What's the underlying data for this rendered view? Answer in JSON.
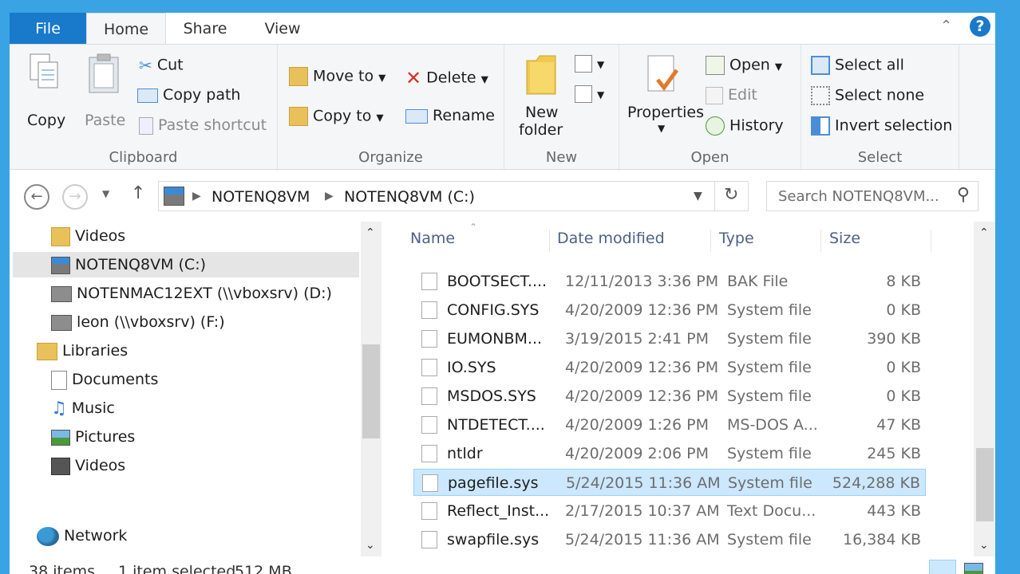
{
  "ribbon_tabs": {
    "file": "File",
    "home": "Home",
    "share": "Share",
    "view": "View"
  },
  "help": "?",
  "clipboard": {
    "copy": "Copy",
    "paste": "Paste",
    "cut": "Cut",
    "copy_path": "Copy path",
    "paste_shortcut": "Paste shortcut",
    "label": "Clipboard"
  },
  "organize": {
    "move_to": "Move to",
    "copy_to": "Copy to",
    "delete": "Delete",
    "rename": "Rename",
    "label": "Organize"
  },
  "new": {
    "new_folder_line1": "New",
    "new_folder_line2": "folder",
    "label": "New"
  },
  "open": {
    "properties": "Properties",
    "open": "Open",
    "edit": "Edit",
    "history": "History",
    "label": "Open"
  },
  "select": {
    "select_all": "Select all",
    "select_none": "Select none",
    "invert": "Invert selection",
    "label": "Select"
  },
  "address": {
    "part1": "NOTENQ8VM",
    "part2": "NOTENQ8VM (C:)"
  },
  "search": {
    "placeholder": "Search NOTENQ8VM..."
  },
  "nav_pane": {
    "items": [
      {
        "label": "Videos",
        "icon": "video-folder-icon"
      },
      {
        "label": "NOTENQ8VM (C:)",
        "icon": "drive-icon"
      },
      {
        "label": "NOTENMAC12EXT (\\\\vboxsrv) (D:)",
        "icon": "network-drive-icon"
      },
      {
        "label": "leon (\\\\vboxsrv) (F:)",
        "icon": "network-drive-icon"
      },
      {
        "label": "Libraries",
        "icon": "libraries-icon"
      },
      {
        "label": "Documents",
        "icon": "documents-icon"
      },
      {
        "label": "Music",
        "icon": "music-icon"
      },
      {
        "label": "Pictures",
        "icon": "pictures-icon"
      },
      {
        "label": "Videos",
        "icon": "videos-icon"
      },
      {
        "label": "Network",
        "icon": "network-icon"
      }
    ]
  },
  "columns": {
    "name": "Name",
    "date": "Date modified",
    "type": "Type",
    "size": "Size"
  },
  "files": [
    {
      "name": "BOOTSECT....",
      "date": "12/11/2013 3:36 PM",
      "type": "BAK File",
      "size": "8 KB"
    },
    {
      "name": "CONFIG.SYS",
      "date": "4/20/2009 12:36 PM",
      "type": "System file",
      "size": "0 KB"
    },
    {
      "name": "EUMONBM...",
      "date": "3/19/2015 2:41 PM",
      "type": "System file",
      "size": "390 KB"
    },
    {
      "name": "IO.SYS",
      "date": "4/20/2009 12:36 PM",
      "type": "System file",
      "size": "0 KB"
    },
    {
      "name": "MSDOS.SYS",
      "date": "4/20/2009 12:36 PM",
      "type": "System file",
      "size": "0 KB"
    },
    {
      "name": "NTDETECT....",
      "date": "4/20/2009 1:26 PM",
      "type": "MS-DOS A...",
      "size": "47 KB"
    },
    {
      "name": "ntldr",
      "date": "4/20/2009 2:06 PM",
      "type": "System file",
      "size": "245 KB"
    },
    {
      "name": "pagefile.sys",
      "date": "5/24/2015 11:36 AM",
      "type": "System file",
      "size": "524,288 KB"
    },
    {
      "name": "Reflect_Inst...",
      "date": "2/17/2015 10:37 AM",
      "type": "Text Docu...",
      "size": "443 KB"
    },
    {
      "name": "swapfile.sys",
      "date": "5/24/2015 11:36 AM",
      "type": "System file",
      "size": "16,384 KB"
    }
  ],
  "status": {
    "items": "38 items",
    "selected": "1 item selected",
    "size": "512 MB"
  },
  "colors": {
    "accent": "#1979ca",
    "selection": "#cce8ff",
    "window_border": "#3aa3e3"
  }
}
